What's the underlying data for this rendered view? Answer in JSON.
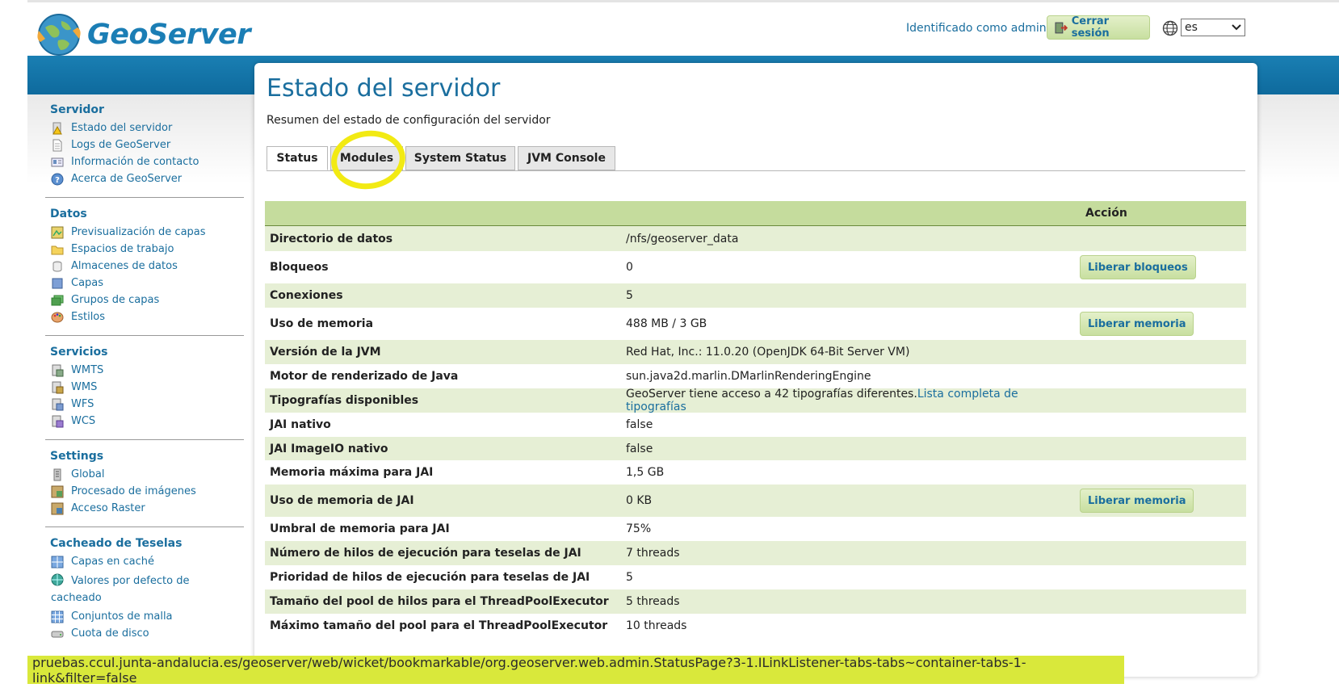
{
  "app": {
    "name": "GeoServer"
  },
  "header": {
    "login_text": "Identificado como admin.",
    "logout_label": "Cerrar sesión",
    "language": "es"
  },
  "sidebar": {
    "sections": [
      {
        "title": "Servidor",
        "items": [
          {
            "label": "Estado del servidor",
            "icon": "server-status-icon"
          },
          {
            "label": "Logs de GeoServer",
            "icon": "document-icon"
          },
          {
            "label": "Información de contacto",
            "icon": "contact-card-icon"
          },
          {
            "label": "Acerca de GeoServer",
            "icon": "help-icon"
          }
        ]
      },
      {
        "title": "Datos",
        "items": [
          {
            "label": "Previsualización de capas",
            "icon": "layer-preview-icon"
          },
          {
            "label": "Espacios de trabajo",
            "icon": "folder-icon"
          },
          {
            "label": "Almacenes de datos",
            "icon": "database-icon"
          },
          {
            "label": "Capas",
            "icon": "layer-icon"
          },
          {
            "label": "Grupos de capas",
            "icon": "layer-group-icon"
          },
          {
            "label": "Estilos",
            "icon": "palette-icon"
          }
        ]
      },
      {
        "title": "Servicios",
        "items": [
          {
            "label": "WMTS",
            "icon": "service-icon"
          },
          {
            "label": "WMS",
            "icon": "service-icon"
          },
          {
            "label": "WFS",
            "icon": "service-icon"
          },
          {
            "label": "WCS",
            "icon": "service-icon"
          }
        ]
      },
      {
        "title": "Settings",
        "items": [
          {
            "label": "Global",
            "icon": "settings-icon"
          },
          {
            "label": "Procesado de imágenes",
            "icon": "image-processing-icon"
          },
          {
            "label": "Acceso Raster",
            "icon": "raster-icon"
          }
        ]
      },
      {
        "title": "Cacheado de Teselas",
        "items": [
          {
            "label": "Capas en caché",
            "icon": "grid-icon"
          },
          {
            "label": "Valores por defecto de cacheado",
            "icon": "globe-icon"
          },
          {
            "label": "Conjuntos de malla",
            "icon": "grid-icon"
          },
          {
            "label": "Cuota de disco",
            "icon": "disk-icon"
          }
        ]
      }
    ]
  },
  "page": {
    "title": "Estado del servidor",
    "description": "Resumen del estado de configuración del servidor",
    "tabs": [
      "Status",
      "Modules",
      "System Status",
      "JVM Console"
    ],
    "active_tab": "Status"
  },
  "table": {
    "action_header": "Acción",
    "rows": [
      {
        "key": "Directorio de datos",
        "value": "/nfs/geoserver_data",
        "action": ""
      },
      {
        "key": "Bloqueos",
        "value": "0",
        "action": "Liberar bloqueos"
      },
      {
        "key": "Conexiones",
        "value": "5",
        "action": ""
      },
      {
        "key": "Uso de memoria",
        "value": "488 MB / 3 GB",
        "action": "Liberar memoria"
      },
      {
        "key": "Versión de la JVM",
        "value": "Red Hat, Inc.: 11.0.20 (OpenJDK 64-Bit Server VM)",
        "action": ""
      },
      {
        "key": "Motor de renderizado de Java",
        "value": "sun.java2d.marlin.DMarlinRenderingEngine",
        "action": ""
      },
      {
        "key": "Tipografías disponibles",
        "value": "GeoServer tiene acceso a 42 tipografías diferentes.",
        "link": "Lista completa de tipografías",
        "action": ""
      },
      {
        "key": "JAI nativo",
        "value": "false",
        "action": ""
      },
      {
        "key": "JAI ImageIO nativo",
        "value": "false",
        "action": ""
      },
      {
        "key": "Memoria máxima para JAI",
        "value": "1,5 GB",
        "action": ""
      },
      {
        "key": "Uso de memoria de JAI",
        "value": "0 KB",
        "action": "Liberar memoria"
      },
      {
        "key": "Umbral de memoria para JAI",
        "value": "75%",
        "action": ""
      },
      {
        "key": "Número de hilos de ejecución para teselas de JAI",
        "value": "7 threads",
        "action": ""
      },
      {
        "key": "Prioridad de hilos de ejecución para teselas de JAI",
        "value": "5",
        "action": ""
      },
      {
        "key": "Tamaño del pool de hilos para el ThreadPoolExecutor",
        "value": "5 threads",
        "action": ""
      },
      {
        "key": "Máximo tamaño del pool para el ThreadPoolExecutor",
        "value": "10 threads",
        "action": ""
      }
    ]
  },
  "status_url": "pruebas.ccul.junta-andalucia.es/geoserver/web/wicket/bookmarkable/org.geoserver.web.admin.StatusPage?3-1.ILinkListener-tabs-tabs~container-tabs-1-link&filter=false",
  "colors": {
    "accent": "#1a6e9e",
    "band": "#1a7fb3",
    "row_alt": "#e6efd5",
    "header_green": "#c5dc9d",
    "button_green": "#c8dfa0",
    "highlight": "#f2ea13"
  }
}
